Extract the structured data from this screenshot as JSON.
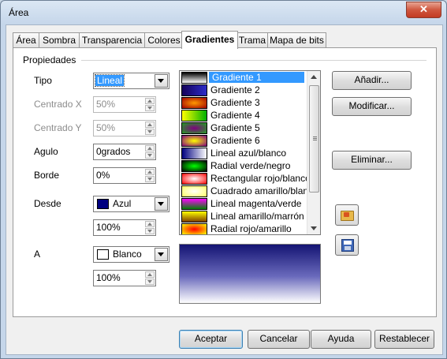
{
  "window": {
    "title": "Área",
    "close_label": "✕"
  },
  "tabs": [
    {
      "label": "Área",
      "active": false
    },
    {
      "label": "Sombra",
      "active": false
    },
    {
      "label": "Transparencia",
      "active": false
    },
    {
      "label": "Colores",
      "active": false
    },
    {
      "label": "Gradientes",
      "active": true
    },
    {
      "label": "Trama",
      "active": false
    },
    {
      "label": "Mapa de bits",
      "active": false
    }
  ],
  "properties": {
    "section_title": "Propiedades",
    "tipo": {
      "label": "Tipo",
      "value": "Lineal"
    },
    "centrado_x": {
      "label": "Centrado X",
      "value": "50%"
    },
    "centrado_y": {
      "label": "Centrado Y",
      "value": "50%"
    },
    "angulo": {
      "label": "Agulo",
      "value": "0grados"
    },
    "borde": {
      "label": "Borde",
      "value": "0%"
    },
    "desde": {
      "label": "Desde",
      "color_name": "Azul",
      "color": "#000080",
      "intensity": "100%"
    },
    "a": {
      "label": "A",
      "color_name": "Blanco",
      "color": "#ffffff",
      "intensity": "100%"
    }
  },
  "gradients": [
    {
      "name": "Gradiente 1",
      "selected": true,
      "css": "linear-gradient(#000,#fff)"
    },
    {
      "name": "Gradiente 2",
      "selected": false,
      "css": "linear-gradient(90deg,#14005a,#2c2cc8)"
    },
    {
      "name": "Gradiente 3",
      "selected": false,
      "css": "radial-gradient(#ff9900,#a00000)"
    },
    {
      "name": "Gradiente 4",
      "selected": false,
      "css": "linear-gradient(90deg,#ffff00,#00b000)"
    },
    {
      "name": "Gradiente 5",
      "selected": false,
      "css": "radial-gradient(#800080,#20a020)"
    },
    {
      "name": "Gradiente 6",
      "selected": false,
      "css": "radial-gradient(#ffff00,#800080)"
    },
    {
      "name": "Lineal azul/blanco",
      "selected": false,
      "css": "linear-gradient(90deg,#000080,#ffffff)"
    },
    {
      "name": "Radial verde/negro",
      "selected": false,
      "css": "radial-gradient(#00ff00,#000)"
    },
    {
      "name": "Rectangular rojo/blanco",
      "selected": false,
      "css": "radial-gradient(#ffffff,#ff0000)"
    },
    {
      "name": "Cuadrado amarillo/blanco",
      "selected": false,
      "css": "radial-gradient(#ffffff,#ffff60)"
    },
    {
      "name": "Lineal magenta/verde",
      "selected": false,
      "css": "linear-gradient(#ff00ff,#008000)"
    },
    {
      "name": "Lineal amarillo/marrón",
      "selected": false,
      "css": "linear-gradient(#ffff00,#804000)"
    },
    {
      "name": "Radial rojo/amarillo",
      "selected": false,
      "css": "radial-gradient(#ff0000,#ffff00)"
    }
  ],
  "side_buttons": {
    "add": "Añadir...",
    "modify": "Modificar...",
    "delete": "Eliminar..."
  },
  "footer": {
    "ok": "Aceptar",
    "cancel": "Cancelar",
    "help": "Ayuda",
    "reset": "Restablecer"
  }
}
